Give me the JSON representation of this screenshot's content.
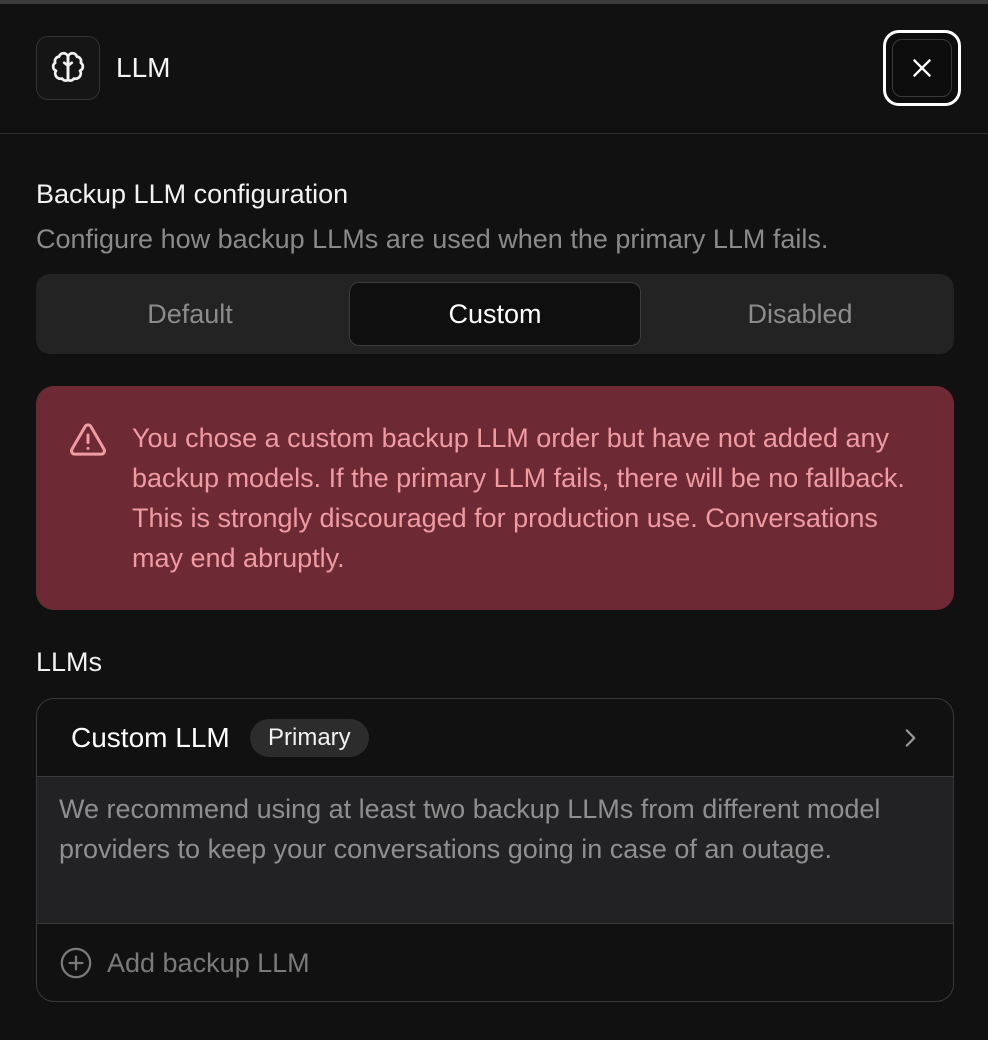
{
  "header": {
    "title": "LLM",
    "app_icon": "brain-icon",
    "close_icon": "close-icon"
  },
  "backup_config": {
    "title": "Backup LLM configuration",
    "description": "Configure how backup LLMs are used when the primary LLM fails.",
    "options": [
      {
        "label": "Default",
        "selected": false
      },
      {
        "label": "Custom",
        "selected": true
      },
      {
        "label": "Disabled",
        "selected": false
      }
    ]
  },
  "alert": {
    "icon": "warning-icon",
    "text": "You chose a custom backup LLM order but have not added any backup models. If the primary LLM fails, there will be no fallback. This is strongly discouraged for production use. Conversations may end abruptly."
  },
  "llms": {
    "title": "LLMs",
    "primary": {
      "name": "Custom LLM",
      "badge": "Primary"
    },
    "recommendation": "We recommend using at least two backup LLMs from different model providers to keep your conversations going in case of an outage.",
    "add_label": "Add backup LLM"
  },
  "colors": {
    "background": "#111111",
    "alert_bg": "#6e2a34",
    "alert_text": "#f09aa2",
    "muted_text": "#8a8a8a"
  }
}
